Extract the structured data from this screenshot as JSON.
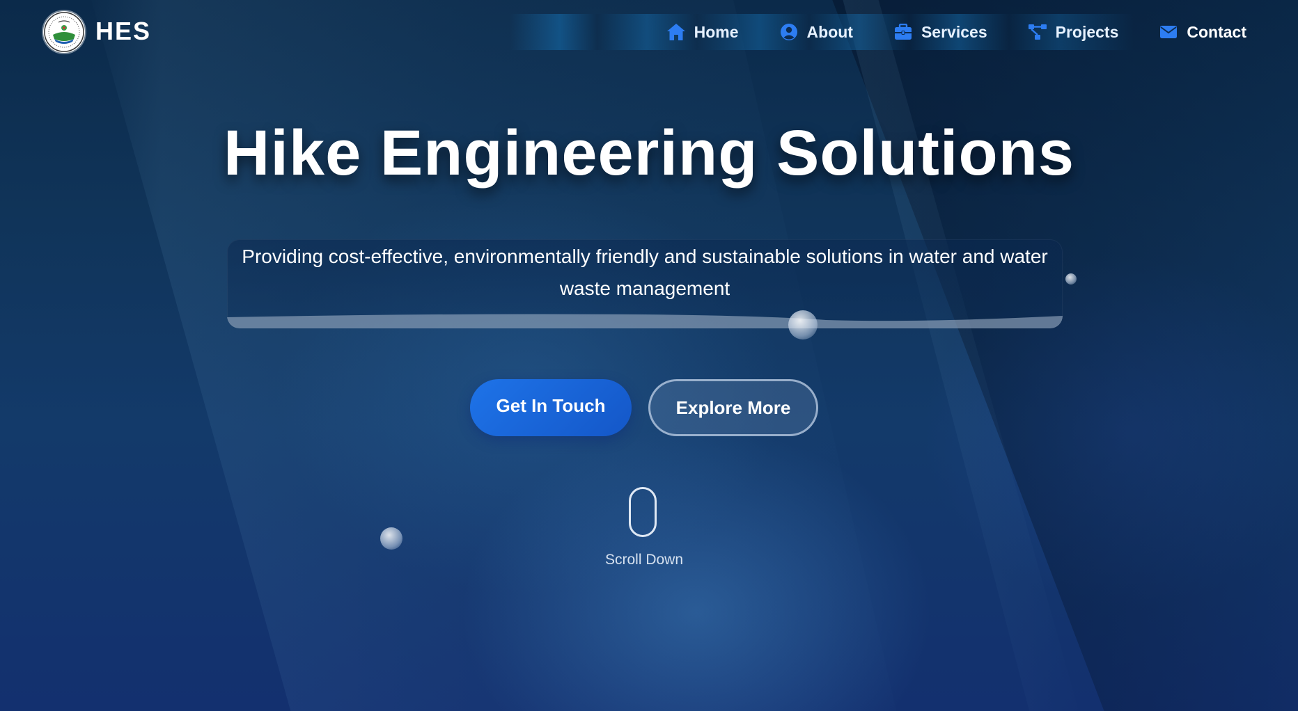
{
  "header": {
    "brand": "HES",
    "logo_icon": "circular-seal-logo-icon",
    "nav": [
      {
        "label": "Home",
        "icon": "house-icon"
      },
      {
        "label": "About",
        "icon": "user-circle-icon"
      },
      {
        "label": "Services",
        "icon": "briefcase-icon"
      },
      {
        "label": "Projects",
        "icon": "project-diagram-icon"
      },
      {
        "label": "Contact",
        "icon": "envelope-icon"
      }
    ]
  },
  "hero": {
    "title": "Hike Engineering Solutions",
    "tagline": "Providing cost-effective, environmentally friendly and sustainable solutions in water and water waste management",
    "primary_button": "Get In Touch",
    "secondary_button": "Explore More",
    "scroll_label": "Scroll Down"
  },
  "colors": {
    "accent_blue": "#1e73e8",
    "nav_icon_blue": "#2d7df2",
    "background_dark": "#0b2a4a",
    "text_white": "#ffffff"
  }
}
